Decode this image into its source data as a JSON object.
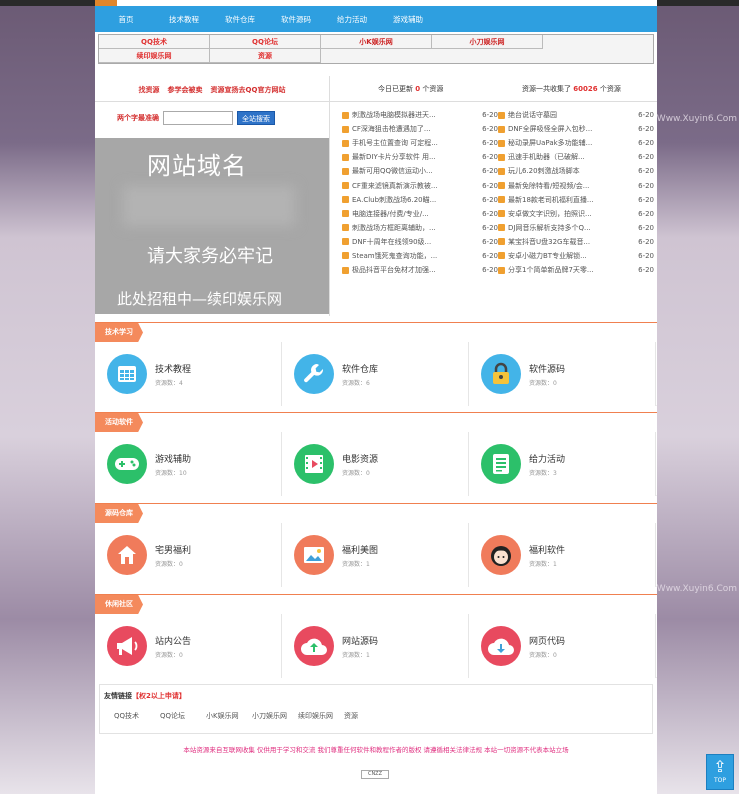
{
  "background": {
    "watermark1": "Www.Xuyin6.Com",
    "watermark2": "Www.Xuyin6.Com"
  },
  "nav": {
    "items": [
      "首页",
      "技术教程",
      "软件仓库",
      "软件源码",
      "给力活动",
      "游戏辅助"
    ]
  },
  "top_links": {
    "row1": [
      "QQ技术",
      "QQ论坛",
      "小K娱乐网",
      "小刀娱乐网"
    ],
    "row2": [
      "续印娱乐网",
      "资源"
    ]
  },
  "tags": [
    "找资源",
    "参学会被卖",
    "资源宣扬去QQ官方网站"
  ],
  "search": {
    "label": "两个字最准确",
    "placeholder": "",
    "button": "全站搜索"
  },
  "ad": {
    "line1": "网站域名",
    "line2": "请大家务必牢记",
    "line3": "此处招租中—续印娱乐网"
  },
  "stats": {
    "today_prefix": "今日已更新",
    "today_count": "0",
    "today_suffix": "个资源",
    "total_prefix": "资源一共收集了",
    "total_count": "60026",
    "total_suffix": "个资源"
  },
  "list_left": [
    {
      "title": "刺激战场电脑模拟器进天...",
      "date": "6-20"
    },
    {
      "title": "CF深海狙击枪遭遇加了...",
      "date": "6-20"
    },
    {
      "title": "手机号主位置查询 可定程...",
      "date": "6-20"
    },
    {
      "title": "最新DIY卡片分享软件 用...",
      "date": "6-20"
    },
    {
      "title": "最新可用QQ微信运动小...",
      "date": "6-20"
    },
    {
      "title": "CF重来滤镜真新演示教被...",
      "date": "6-20"
    },
    {
      "title": "EA.Club刺激战场6.20瞄...",
      "date": "6-20"
    },
    {
      "title": "电脑连接器/付费/专业/...",
      "date": "6-20"
    },
    {
      "title": "刺激战场方框距离辅助，...",
      "date": "6-20"
    },
    {
      "title": "DNF十周年在线领90级...",
      "date": "6-20"
    },
    {
      "title": "Steam饿死鬼查询功能，...",
      "date": "6-20"
    },
    {
      "title": "极品抖音平台免材才加强...",
      "date": "6-20"
    }
  ],
  "list_right": [
    {
      "title": "绝台说话守墓园",
      "date": "6-20"
    },
    {
      "title": "DNF全屏吸怪全屏入包秒...",
      "date": "6-20"
    },
    {
      "title": "秘动录屏UaPak多功能辅...",
      "date": "6-20"
    },
    {
      "title": "迅速手机助器（已破解...",
      "date": "6-20"
    },
    {
      "title": "玩儿6.20刺激战场脚本",
      "date": "6-20"
    },
    {
      "title": "最新免除特看/短视频/会...",
      "date": "6-20"
    },
    {
      "title": "最新18款老司机福利直播...",
      "date": "6-20"
    },
    {
      "title": "安卓做文字识别，拍照识...",
      "date": "6-20"
    },
    {
      "title": "DJ网音乐解析支持多个Q...",
      "date": "6-20"
    },
    {
      "title": "某宝抖音U盘32G车载音...",
      "date": "6-20"
    },
    {
      "title": "安卓小磁力BT专业解锁...",
      "date": "6-20"
    },
    {
      "title": "分享1个简单新品牌7天零...",
      "date": "6-20"
    }
  ],
  "categories": [
    {
      "label": "技术学习",
      "cards": [
        {
          "name": "技术教程",
          "count": "资源数：4",
          "color": "#43b4e8",
          "icon": "table-icon"
        },
        {
          "name": "软件仓库",
          "count": "资源数：6",
          "color": "#43b4e8",
          "icon": "wrench-icon"
        },
        {
          "name": "软件源码",
          "count": "资源数：0",
          "color": "#43b4e8",
          "icon": "lock-icon"
        }
      ]
    },
    {
      "label": "活动软件",
      "cards": [
        {
          "name": "游戏辅助",
          "count": "资源数：10",
          "color": "#2cc06a",
          "icon": "gamepad-icon"
        },
        {
          "name": "电影资源",
          "count": "资源数：0",
          "color": "#2cc06a",
          "icon": "film-icon"
        },
        {
          "name": "给力活动",
          "count": "资源数：3",
          "color": "#2cc06a",
          "icon": "document-icon"
        }
      ]
    },
    {
      "label": "源码仓库",
      "cards": [
        {
          "name": "宅男福利",
          "count": "资源数：0",
          "color": "#f07b5b",
          "icon": "house-icon"
        },
        {
          "name": "福利美图",
          "count": "资源数：1",
          "color": "#f07b5b",
          "icon": "image-icon"
        },
        {
          "name": "福利软件",
          "count": "资源数：1",
          "color": "#f07b5b",
          "icon": "girl-icon"
        }
      ]
    },
    {
      "label": "休闲社区",
      "cards": [
        {
          "name": "站内公告",
          "count": "资源数：0",
          "color": "#e84a5f",
          "icon": "megaphone-icon"
        },
        {
          "name": "网站源码",
          "count": "资源数：1",
          "color": "#e84a5f",
          "icon": "cloud-upload-icon"
        },
        {
          "name": "网页代码",
          "count": "资源数：0",
          "color": "#e84a5f",
          "icon": "cloud-download-icon"
        }
      ]
    }
  ],
  "friends": {
    "title": "友情链接",
    "request": "【权2以上申请】",
    "links": [
      "QQ技术",
      "QQ论坛",
      "小K娱乐网",
      "小刀娱乐网",
      "续印娱乐网",
      "资源"
    ]
  },
  "footer": {
    "text": "本站资源来自互联网收集 仅供用于学习和交流 我们尊重任何软件和教程作者的版权 请遵循相关法律法规 本站一切资源不代表本站立场",
    "badge": "CNZZ"
  },
  "totop": {
    "label": "TOP"
  }
}
